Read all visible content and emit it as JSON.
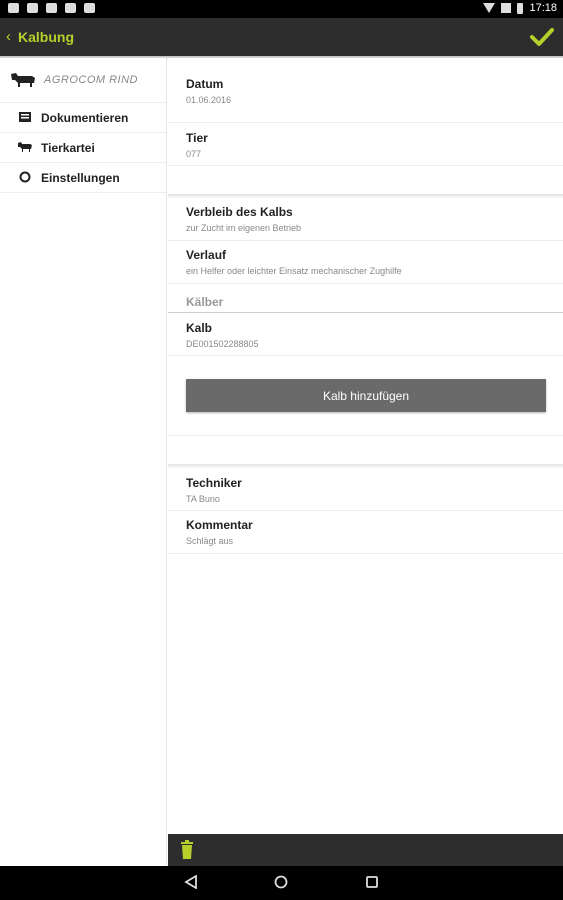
{
  "statusbar": {
    "time": "17:18"
  },
  "actionbar": {
    "back_icon": "‹",
    "title": "Kalbung"
  },
  "sidebar": {
    "brand": "AGROCOM RIND",
    "items": [
      {
        "label": "Dokumentieren",
        "icon": "document-icon"
      },
      {
        "label": "Tierkartei",
        "icon": "cow-icon"
      },
      {
        "label": "Einstellungen",
        "icon": "settings-circle-icon"
      }
    ]
  },
  "form": {
    "datum": {
      "label": "Datum",
      "value": "01.06.2016"
    },
    "tier": {
      "label": "Tier",
      "value": "077"
    },
    "verbleib": {
      "label": "Verbleib des Kalbs",
      "value": "zur Zucht im eigenen Betrieb"
    },
    "verlauf": {
      "label": "Verlauf",
      "value": "ein Helfer oder leichter Einsatz mechanischer Zughilfe"
    },
    "kaelber_header": "Kälber",
    "kalb": {
      "label": "Kalb",
      "value": "DE001502288805"
    },
    "add_button": "Kalb hinzufügen",
    "techniker": {
      "label": "Techniker",
      "value": "TA Buno"
    },
    "kommentar": {
      "label": "Kommentar",
      "value": "Schlägt aus"
    }
  },
  "colors": {
    "accent": "#b6cf2a",
    "bar": "#2d2d2d",
    "button": "#6a6a6a"
  }
}
